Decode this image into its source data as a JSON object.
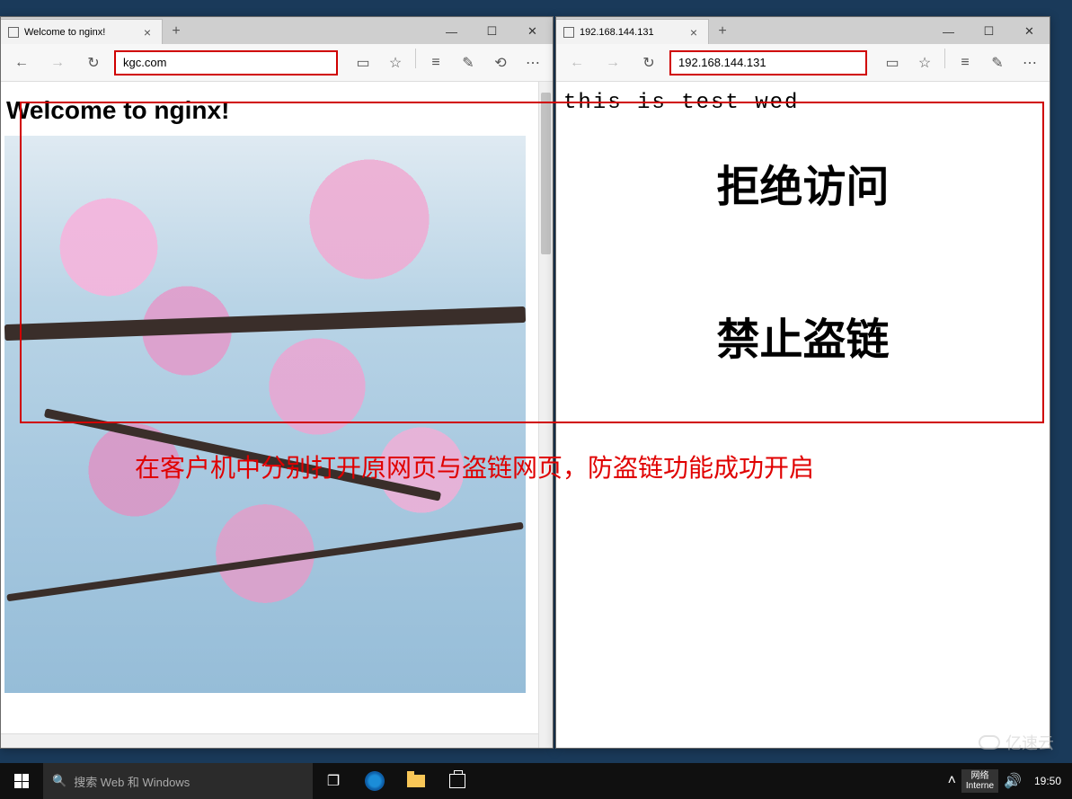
{
  "windows": {
    "left": {
      "tab_title": "Welcome to nginx!",
      "url": "kgc.com",
      "page_heading": "Welcome to nginx!"
    },
    "right": {
      "tab_title": "192.168.144.131",
      "url": "192.168.144.131",
      "text_line": "this is test wed",
      "deny_text": "拒绝访问",
      "forbid_text": "禁止盗链"
    }
  },
  "annotation": {
    "overlay_text": "在客户机中分别打开原网页与盗链网页，防盗链功能成功开启"
  },
  "taskbar": {
    "search_placeholder": "搜索 Web 和 Windows",
    "network_label_1": "网络",
    "network_label_2": "Interne",
    "clock": "19:50"
  },
  "watermark": "亿速云",
  "icons": {
    "back": "←",
    "forward": "→",
    "refresh": "↻",
    "reading": "▭",
    "star": "☆",
    "hub": "≡",
    "note": "✎",
    "share": "⟲",
    "more": "⋯",
    "close": "×",
    "plus": "+",
    "min": "—",
    "max": "☐",
    "winclose": "✕",
    "search": "🔍",
    "taskview": "❐",
    "chevup": "˄",
    "volume": "🔊"
  }
}
